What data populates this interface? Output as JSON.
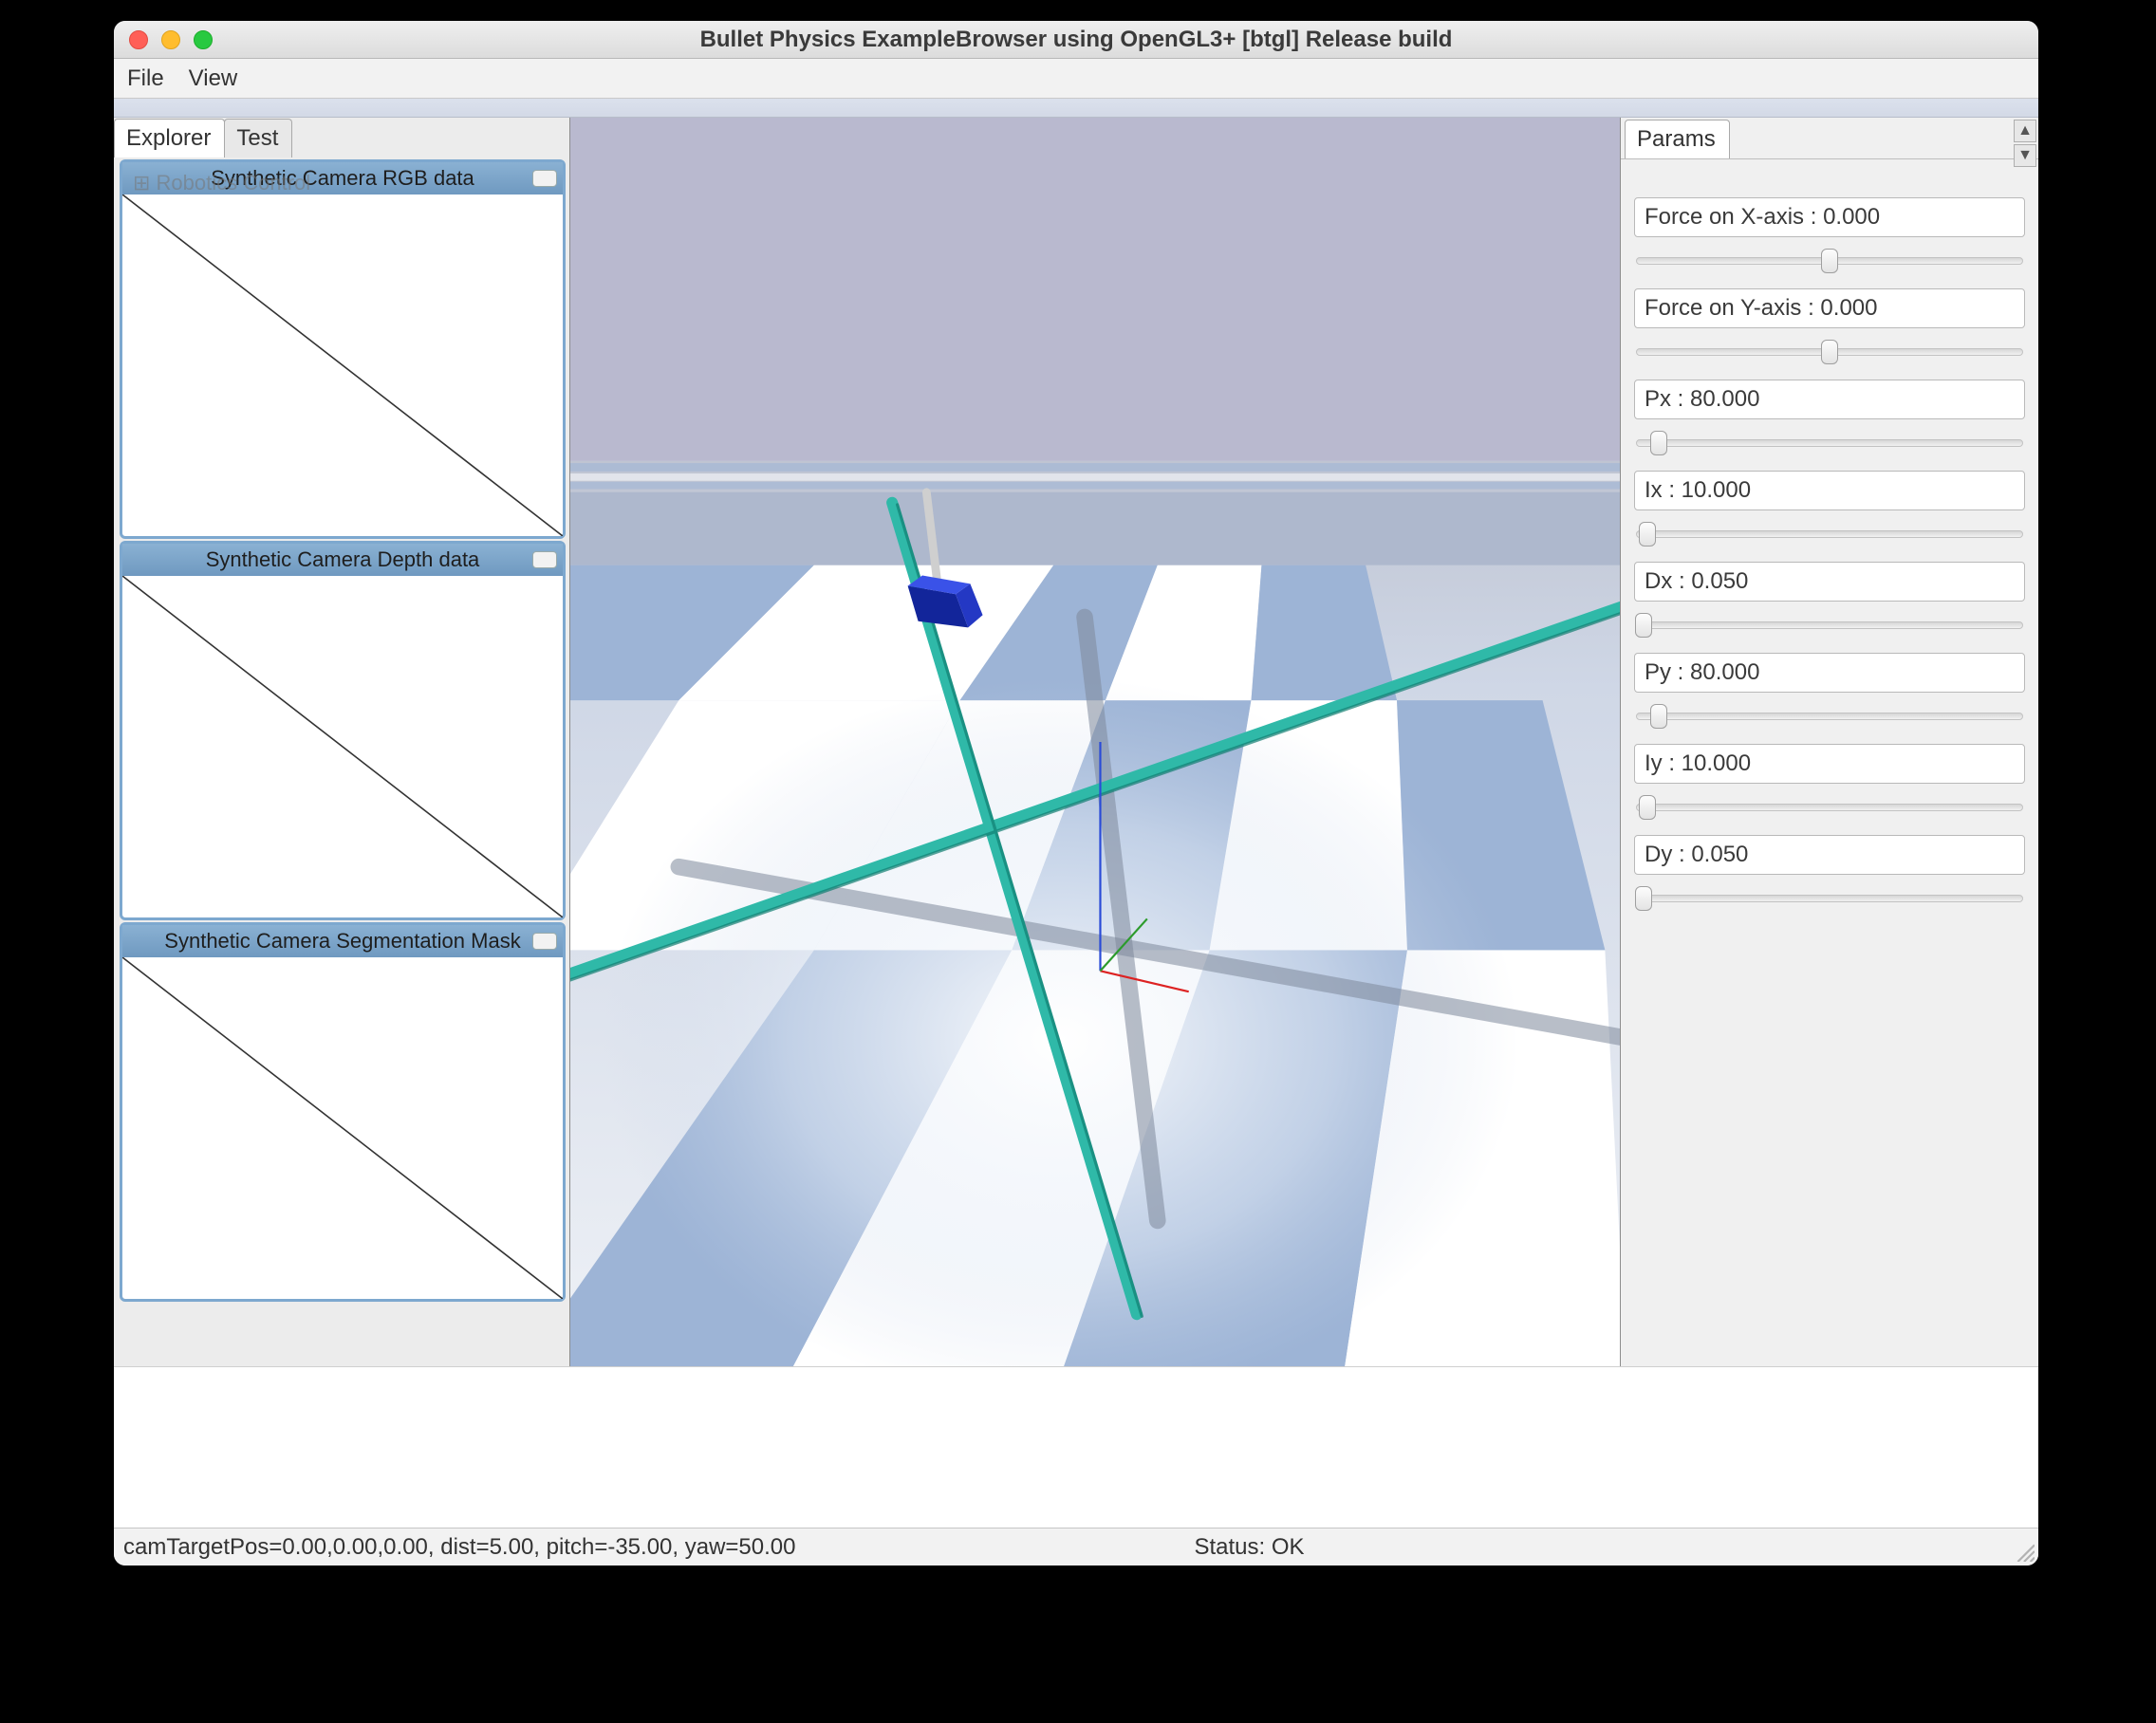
{
  "window": {
    "title": "Bullet Physics ExampleBrowser using OpenGL3+ [btgl] Release build"
  },
  "menu": {
    "file": "File",
    "view": "View"
  },
  "left": {
    "tab_explorer": "Explorer",
    "tab_test": "Test",
    "tree_hint": "⊞ Robotics Control",
    "cam_rgb": "Synthetic Camera RGB data",
    "cam_depth": "Synthetic Camera Depth data",
    "cam_seg": "Synthetic Camera Segmentation Mask"
  },
  "right": {
    "tab_params": "Params"
  },
  "params": [
    {
      "label": "Force on X-axis : 0.000",
      "pos": 50
    },
    {
      "label": "Force on Y-axis : 0.000",
      "pos": 50
    },
    {
      "label": "Px : 80.000",
      "pos": 6
    },
    {
      "label": "Ix : 10.000",
      "pos": 3
    },
    {
      "label": "Dx : 0.050",
      "pos": 2
    },
    {
      "label": "Py : 80.000",
      "pos": 6
    },
    {
      "label": "Iy : 10.000",
      "pos": 3
    },
    {
      "label": "Dy : 0.050",
      "pos": 2
    }
  ],
  "status": {
    "camera": "camTargetPos=0.00,0.00,0.00, dist=5.00, pitch=-35.00, yaw=50.00",
    "ok": "Status: OK"
  }
}
